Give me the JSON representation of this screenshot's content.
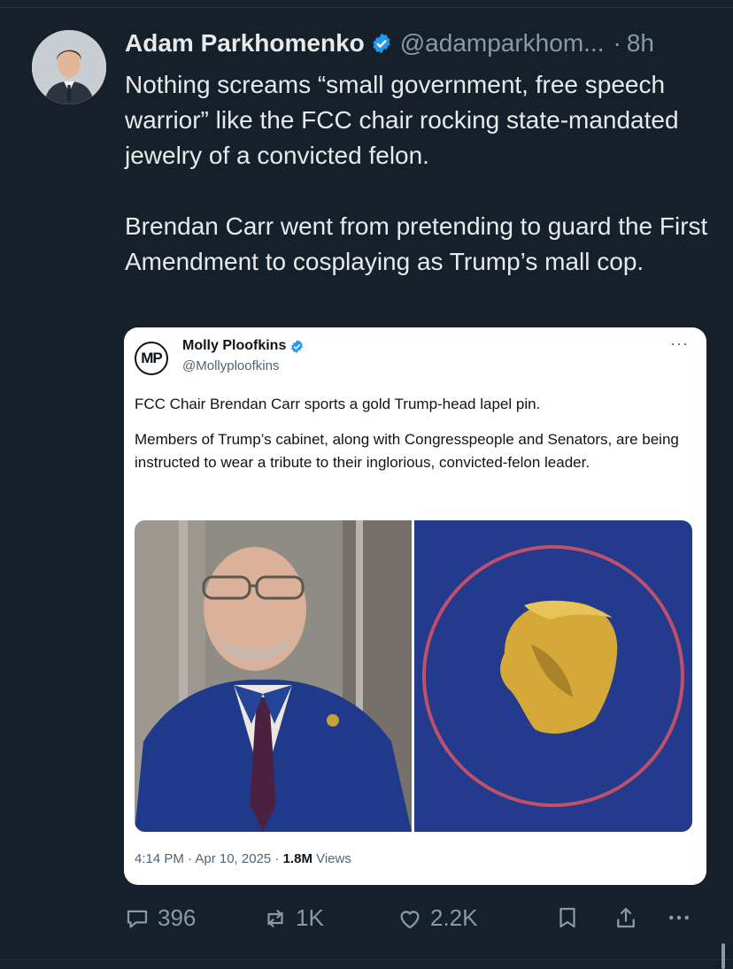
{
  "post": {
    "author_name": "Adam Parkhomenko",
    "author_handle": "@adamparkhom...",
    "separator": "·",
    "time": "8h",
    "text": "Nothing screams “small government, free speech warrior” like the FCC chair rocking state-mandated jewelry of a convicted felon.\n\nBrendan Carr went from pretending to guard the First Amendment to cosplaying as Trump’s mall cop."
  },
  "quoted": {
    "avatar_text": "MP",
    "name": "Molly Ploofkins",
    "handle": "@Mollyploofkins",
    "more": "···",
    "paragraph1": "FCC Chair Brendan Carr sports a gold Trump-head lapel pin.",
    "paragraph2": "Members of Trump’s cabinet, along with Congresspeople and Senators, are being instructed to wear a tribute to their inglorious, convicted-felon leader.",
    "meta_time": "4:14 PM · Apr 10, 2025 · ",
    "views_count": "1.8M",
    "views_label": " Views"
  },
  "actions": {
    "replies": "396",
    "reposts": "1K",
    "likes": "2.2K"
  },
  "colors": {
    "background": "#15202b",
    "verified_blue": "#1d9bf0",
    "muted": "#8b98a5"
  }
}
